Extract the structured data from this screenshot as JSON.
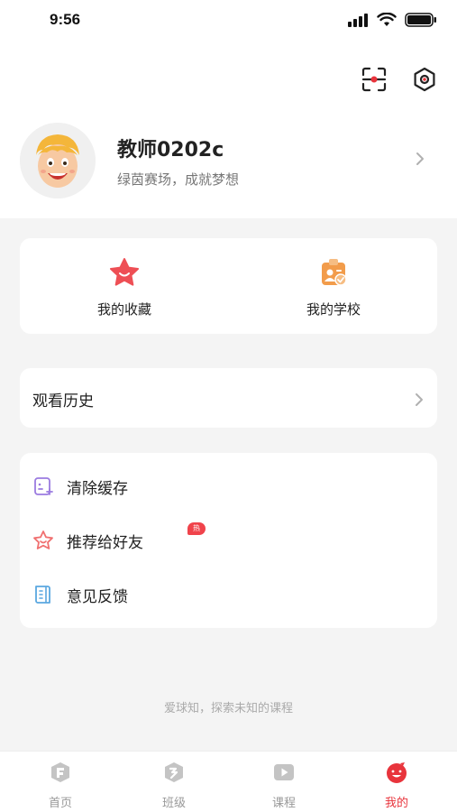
{
  "status_bar": {
    "time": "9:56"
  },
  "profile": {
    "name": "教师0202c",
    "motto": "绿茵赛场，成就梦想"
  },
  "quick_actions": [
    {
      "label": "我的收藏",
      "icon": "star-icon"
    },
    {
      "label": "我的学校",
      "icon": "school-badge-icon"
    }
  ],
  "history": {
    "label": "观看历史"
  },
  "menu": [
    {
      "label": "清除缓存",
      "icon": "clear-cache-icon"
    },
    {
      "label": "推荐给好友",
      "icon": "recommend-star-icon",
      "badge": "热"
    },
    {
      "label": "意见反馈",
      "icon": "feedback-icon"
    }
  ],
  "slogan": "爱球知，探索未知的课程",
  "tabs": [
    {
      "label": "首页",
      "icon": "home-icon",
      "active": false
    },
    {
      "label": "班级",
      "icon": "class-icon",
      "active": false
    },
    {
      "label": "课程",
      "icon": "course-play-icon",
      "active": false
    },
    {
      "label": "我的",
      "icon": "profile-face-icon",
      "active": true
    }
  ],
  "colors": {
    "accent": "#e8343c",
    "school_orange": "#f29c4b",
    "menu_purple": "#9b7be0",
    "menu_red": "#f07070",
    "menu_blue": "#5aa7e0"
  }
}
